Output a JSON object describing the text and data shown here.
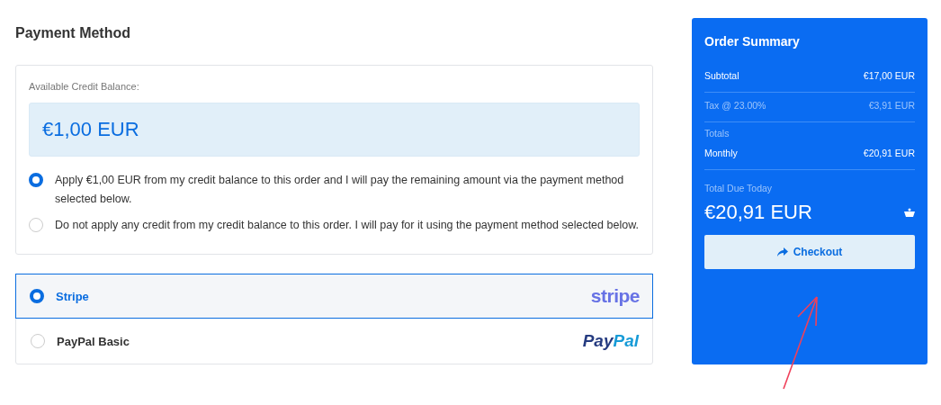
{
  "heading": "Payment Method",
  "credit": {
    "label": "Available Credit Balance:",
    "amount": "€1,00 EUR",
    "options": [
      {
        "text": "Apply €1,00 EUR from my credit balance to this order and I will pay the remaining amount via the payment method selected below.",
        "selected": true
      },
      {
        "text": "Do not apply any credit from my credit balance to this order. I will pay for it using the payment method selected below.",
        "selected": false
      }
    ]
  },
  "gateways": [
    {
      "name": "Stripe",
      "selected": true,
      "kind": "stripe",
      "logo": [
        "stripe"
      ]
    },
    {
      "name": "PayPal Basic",
      "selected": false,
      "kind": "paypal",
      "logo": [
        "Pay",
        "Pal"
      ]
    }
  ],
  "summary": {
    "title": "Order Summary",
    "rows": [
      {
        "kind": "row",
        "label": "Subtotal",
        "value": "€17,00 EUR"
      },
      {
        "kind": "muted",
        "label": "Tax @ 23.00%",
        "value": "€3,91 EUR"
      },
      {
        "kind": "heading",
        "label": "Totals"
      },
      {
        "kind": "row",
        "label": "Monthly",
        "value": "€20,91 EUR"
      }
    ],
    "due_label": "Total Due Today",
    "due_amount": "€20,91 EUR",
    "button": "Checkout"
  }
}
